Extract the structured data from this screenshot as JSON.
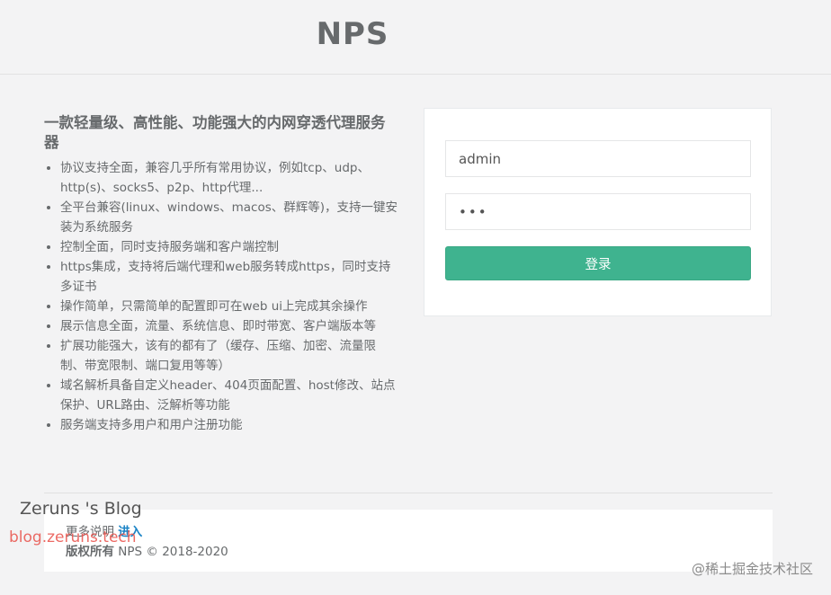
{
  "header": {
    "title": "NPS"
  },
  "intro": {
    "heading": "一款轻量级、高性能、功能强大的内网穿透代理服务器",
    "features": [
      "协议支持全面，兼容几乎所有常用协议，例如tcp、udp、http(s)、socks5、p2p、http代理...",
      "全平台兼容(linux、windows、macos、群辉等)，支持一键安装为系统服务",
      "控制全面，同时支持服务端和客户端控制",
      "https集成，支持将后端代理和web服务转成https，同时支持多证书",
      "操作简单，只需简单的配置即可在web ui上完成其余操作",
      "展示信息全面，流量、系统信息、即时带宽、客户端版本等",
      "扩展功能强大，该有的都有了（缓存、压缩、加密、流量限制、带宽限制、端口复用等等）",
      "域名解析具备自定义header、404页面配置、host修改、站点保护、URL路由、泛解析等功能",
      "服务端支持多用户和用户注册功能"
    ]
  },
  "login": {
    "username_value": "admin",
    "password_value": "•••",
    "submit_label": "登录"
  },
  "footer": {
    "more_prefix": "更多说明",
    "more_link": "进入",
    "copyright_label": "版权所有",
    "copyright_text": "NPS © 2018-2020"
  },
  "watermarks": {
    "blog_name": "Zeruns 's Blog",
    "blog_url": "blog.zeruns.tech",
    "juejin": "@稀土掘金技术社区"
  }
}
